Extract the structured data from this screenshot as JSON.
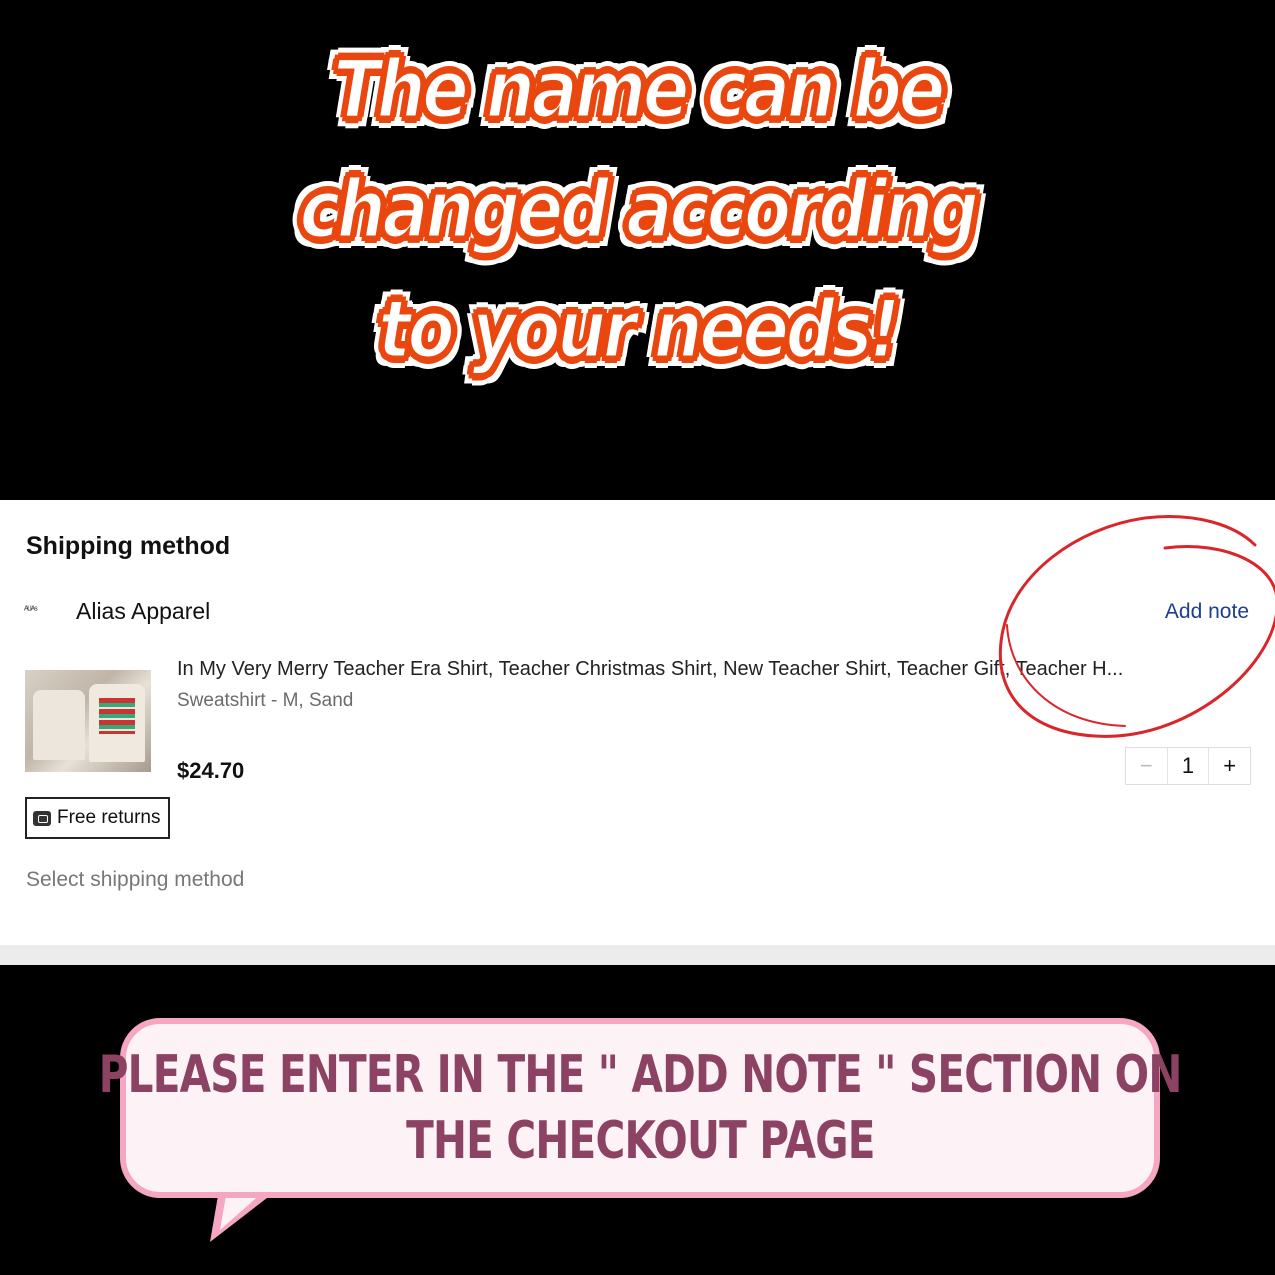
{
  "headline": {
    "lines": [
      "The name can be",
      "changed according",
      "to your needs!"
    ]
  },
  "checkout": {
    "section_title": "Shipping method",
    "seller": {
      "logo_text": "ᴬᴸᴵᴬˢ",
      "name": "Alias Apparel"
    },
    "add_note_label": "Add note",
    "product": {
      "title": "In My Very Merry Teacher Era Shirt, Teacher Christmas Shirt, New Teacher Shirt, Teacher Gift, Teacher H...",
      "variant": "Sweatshirt - M, Sand",
      "price": "$24.70",
      "quantity": "1",
      "minus": "−",
      "plus": "+"
    },
    "returns_label": "Free returns",
    "select_shipping_label": "Select shipping method"
  },
  "callout": {
    "lines": [
      "PLEASE ENTER IN THE \" ADD NOTE \" SECTION ON",
      "THE CHECKOUT PAGE"
    ]
  },
  "colors": {
    "headline_stroke": "#e9470f",
    "link": "#1d3f8c",
    "circle": "#d9262a",
    "bubble_border": "#f5a6c3",
    "bubble_text": "#8c4262"
  },
  "icons": [
    "seller-logo-icon",
    "returns-box-icon",
    "annotation-circle"
  ]
}
